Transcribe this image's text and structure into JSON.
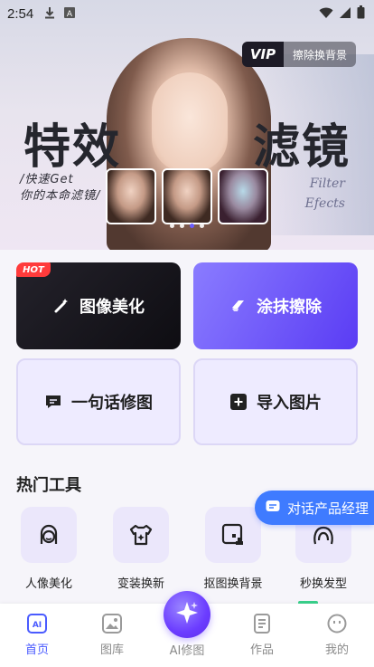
{
  "status_bar": {
    "time": "2:54",
    "icons": [
      "download-icon",
      "a-badge-icon",
      "wifi-icon",
      "signal-icon",
      "battery-icon"
    ]
  },
  "banner": {
    "vip_label": "VIP",
    "vip_action": "擦除换背景",
    "title_left": "特效",
    "title_right": "滤镜",
    "subtitle_line1": "/快速Get",
    "subtitle_line2": "你的本命滤镜/",
    "english_line1": "Filter",
    "english_line2": "Efects",
    "slides_count": 4,
    "active_slide": 2
  },
  "cards": {
    "hot_badge": "HOT",
    "beauty": "图像美化",
    "erase": "涂抹擦除",
    "chat_edit": "一句话修图",
    "import": "导入图片"
  },
  "section": {
    "title": "热门工具"
  },
  "pm_button": "对话产品经理",
  "tools": [
    {
      "label": "人像美化",
      "icon": "portrait-face-icon"
    },
    {
      "label": "变装换新",
      "icon": "outfit-sparkle-icon"
    },
    {
      "label": "抠图换背景",
      "icon": "cutout-icon"
    },
    {
      "label": "秒换发型",
      "icon": "hairstyle-icon"
    }
  ],
  "nav": {
    "home": "首页",
    "gallery": "图库",
    "ai_edit": "AI修图",
    "works": "作品",
    "mine": "我的"
  },
  "colors": {
    "accent": "#4a5bff",
    "purple": "#6b3cff",
    "hot": "#ff3b3b",
    "pm_blue": "#3f7bff"
  }
}
